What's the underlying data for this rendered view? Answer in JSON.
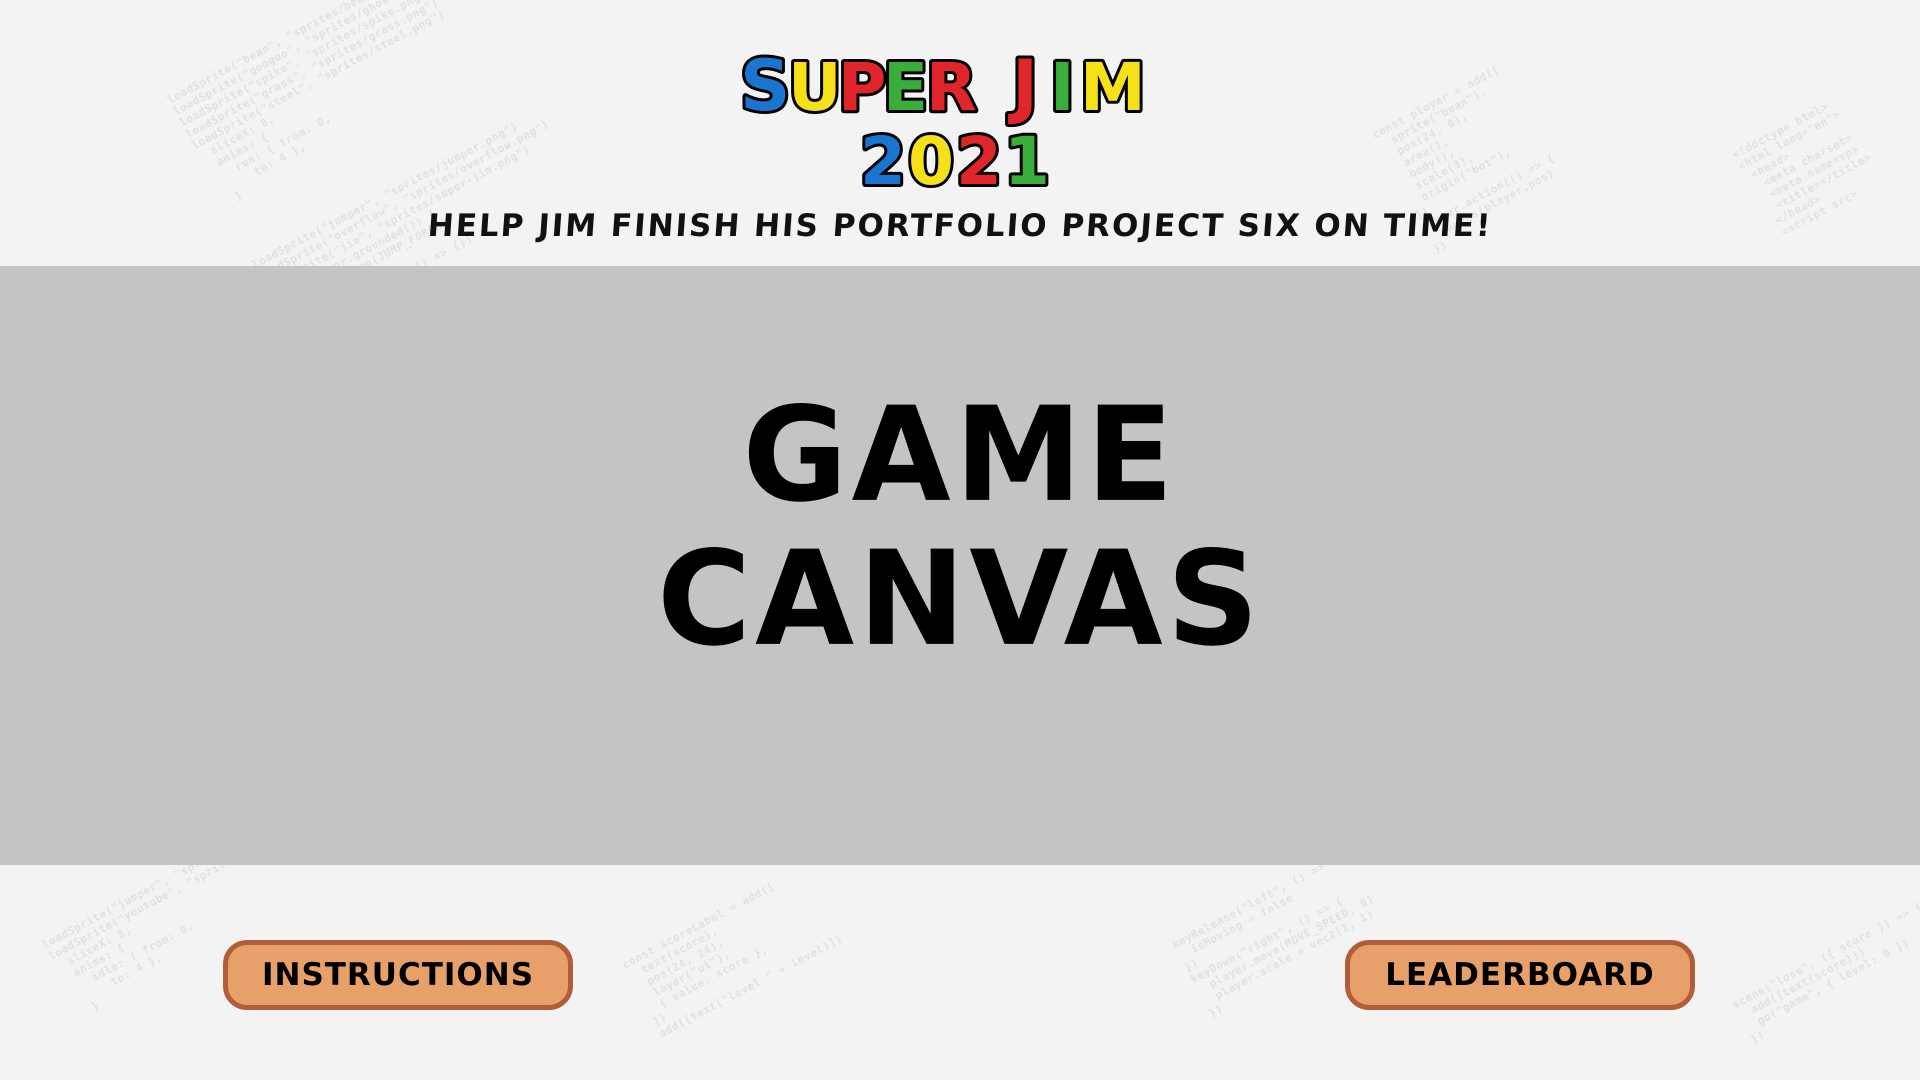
{
  "header": {
    "logo": {
      "line1_word1": "SUPER",
      "line1_word2": "JIM",
      "line2": "2021",
      "colors": [
        "#1a75d1",
        "#f5e11a",
        "#e0262b",
        "#3aae3a"
      ]
    },
    "tagline": "HELP JIM FINISH HIS PORTFOLIO PROJECT SIX ON TIME!"
  },
  "game_canvas": {
    "line1": "GAME",
    "line2": "CANVAS"
  },
  "buttons": {
    "instructions": "INSTRUCTIONS",
    "leaderboard": "LEADERBOARD"
  },
  "theme": {
    "background": "#f3f3f3",
    "canvas_bg": "#c4c4c4",
    "button_fill": "#e8a06b",
    "button_border": "#b25d3a"
  }
}
